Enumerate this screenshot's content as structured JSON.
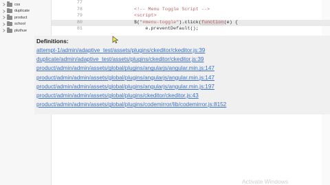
{
  "sidebar": {
    "items": [
      {
        "label": "css",
        "icon": "folder-icon"
      },
      {
        "label": "duplicate",
        "icon": "folder-icon"
      },
      {
        "label": "product",
        "icon": "folder-icon"
      },
      {
        "label": "school",
        "icon": "folder-icon"
      },
      {
        "label": "pluthue",
        "icon": "folder-icon"
      }
    ]
  },
  "editor": {
    "lines": [
      {
        "num": "77",
        "parts": [
          {
            "t": "",
            "c": ""
          }
        ]
      },
      {
        "num": "78",
        "parts": [
          {
            "t": "<!-- Menu Toggle Script -->",
            "c": "cmt"
          }
        ]
      },
      {
        "num": "79",
        "parts": [
          {
            "t": "<script>",
            "c": "tag"
          }
        ]
      },
      {
        "num": "80",
        "parts": [
          {
            "t": "$(",
            "c": "fn"
          },
          {
            "t": "\"#menu-toggle\"",
            "c": "str"
          },
          {
            "t": ").click(",
            "c": "fn"
          },
          {
            "t": "function",
            "c": "kw hl"
          },
          {
            "t": "(e) {",
            "c": "fn"
          }
        ]
      },
      {
        "num": "81",
        "parts": [
          {
            "t": "    e.preventDefault();",
            "c": "fn"
          }
        ]
      }
    ]
  },
  "definitions": {
    "title": "Definitions:",
    "links": [
      "attempt-1/admin/adaptive_test/assets/plugins/ckeditor/ckeditor.js:39",
      "duplicate/admin/adaptive_test/assets/plugins/ckeditor/ckeditor.js:39",
      "product/admin/admin/assets/global/plugins/angularjs/angular.min.js:147",
      "product/admin/admin/assets/global/plugins/angularjs/angular.min.js:147",
      "product/admin/admin/assets/global/plugins/angularjs/angular.min.js:197",
      "product/admin/admin/assets/global/plugins/ckeditor/ckeditor.js:43",
      "product/admin/admin/assets/global/plugins/codemirror/lib/codemirror.js:8152"
    ]
  },
  "watermark": "Activate Windows"
}
